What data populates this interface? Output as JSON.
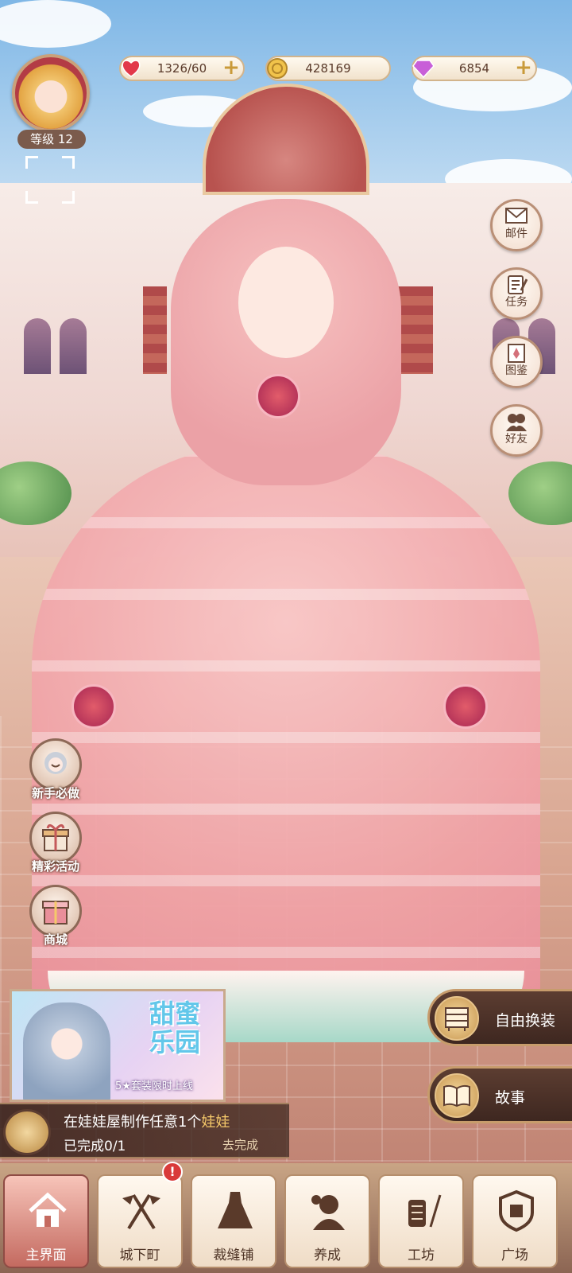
{
  "player": {
    "level_label": "等级 12"
  },
  "resources": {
    "stamina": "1326/60",
    "gold": "428169",
    "diamond": "6854"
  },
  "side_menu": [
    {
      "label": "邮件",
      "icon": "mail-icon"
    },
    {
      "label": "任务",
      "icon": "task-icon"
    },
    {
      "label": "图鉴",
      "icon": "collection-icon"
    },
    {
      "label": "好友",
      "icon": "friends-icon"
    }
  ],
  "events": [
    {
      "label": "新手必做",
      "icon": "newbie-icon"
    },
    {
      "label": "精彩活动",
      "icon": "gift-icon"
    },
    {
      "label": "商城",
      "icon": "shop-icon"
    }
  ],
  "promo": {
    "title": "甜蜜乐园",
    "subtitle": "5★套装限时上线"
  },
  "right_actions": {
    "dress_up": "自由换装",
    "story": "故事"
  },
  "quest": {
    "text": "在娃娃屋制作任意1个",
    "highlight": "娃娃",
    "progress": "已完成0/1",
    "go": "去完成"
  },
  "nav": [
    {
      "label": "主界面",
      "icon": "home-icon"
    },
    {
      "label": "城下町",
      "icon": "flags-icon"
    },
    {
      "label": "裁缝铺",
      "icon": "dress-icon"
    },
    {
      "label": "养成",
      "icon": "growth-icon"
    },
    {
      "label": "工坊",
      "icon": "workshop-icon"
    },
    {
      "label": "广场",
      "icon": "plaza-icon"
    }
  ],
  "nav_alert": "!",
  "colors": {
    "accent": "#c46a60",
    "panel_dark": "#3e2720",
    "gold": "#c99a39",
    "highlight": "#f5c96a"
  }
}
